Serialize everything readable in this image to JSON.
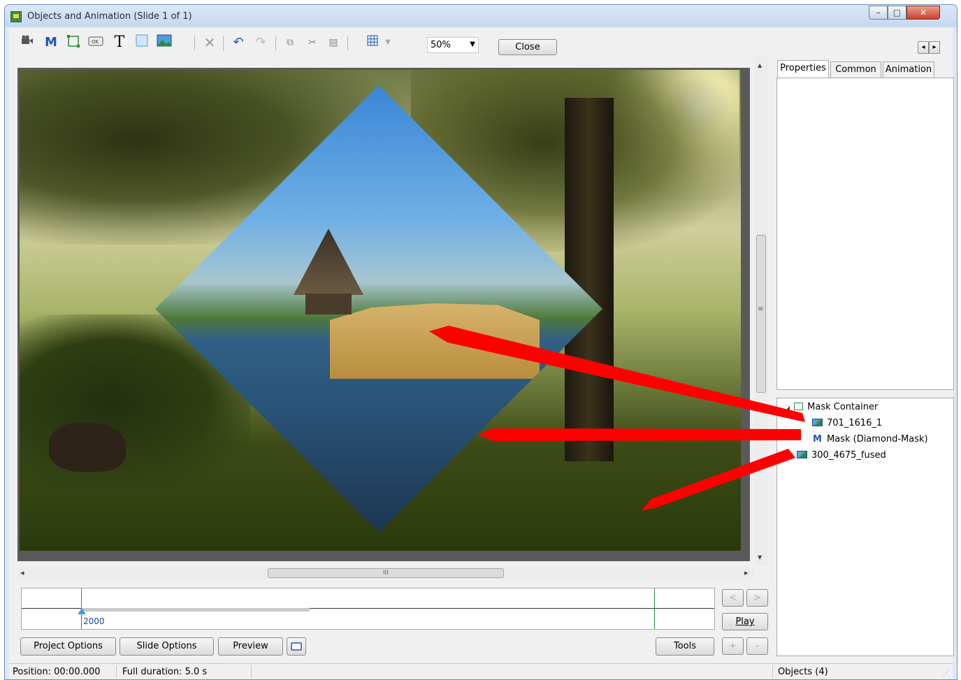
{
  "window": {
    "title": "Objects and Animation  (Slide 1 of 1)",
    "caption_minimize": "–",
    "caption_maximize": "□",
    "caption_close": "✕"
  },
  "toolbar": {
    "icons": [
      "camera-icon",
      "mask-icon",
      "container-icon",
      "button-icon",
      "text-icon",
      "frame-icon",
      "image-icon",
      "delete-icon",
      "undo-icon",
      "redo-icon",
      "copy-icon",
      "cut-icon",
      "paste-icon",
      "grid-icon"
    ],
    "mask_glyph": "M",
    "text_glyph": "T",
    "zoom_value": "50%",
    "close_label": "Close",
    "nav_prev": "◂",
    "nav_next": "▸"
  },
  "timeline": {
    "marker_label": "2000"
  },
  "timeline_controls": {
    "prev": "<",
    "next": ">",
    "play_label": "Play",
    "plus": "+",
    "minus": "-"
  },
  "bottom_buttons": {
    "project_options": "Project Options",
    "slide_options": "Slide Options",
    "preview": "Preview",
    "tools": "Tools"
  },
  "tabs": [
    {
      "label": "Properties",
      "active": true
    },
    {
      "label": "Common",
      "active": false
    },
    {
      "label": "Animation",
      "active": false
    }
  ],
  "object_tree": {
    "container": "Mask Container",
    "children": [
      {
        "label": "701_1616_1",
        "type": "image"
      },
      {
        "label": "Mask (Diamond-Mask)",
        "type": "mask"
      }
    ],
    "sibling": {
      "label": "300_4675_fused",
      "type": "image"
    }
  },
  "statusbar": {
    "position": "Position:  00:00.000",
    "duration": "Full duration:  5.0 s",
    "objects": "Objects (4)"
  },
  "scrollbar": {
    "h_thumb_grip": "III",
    "v_thumb_grip": "≡",
    "up": "▲",
    "down": "▼",
    "left": "◂",
    "right": "▸"
  },
  "colors": {
    "annotation_arrow": "#ff0000",
    "accent_blue": "#1a55c4",
    "timeline_green": "#2d8c3c"
  }
}
